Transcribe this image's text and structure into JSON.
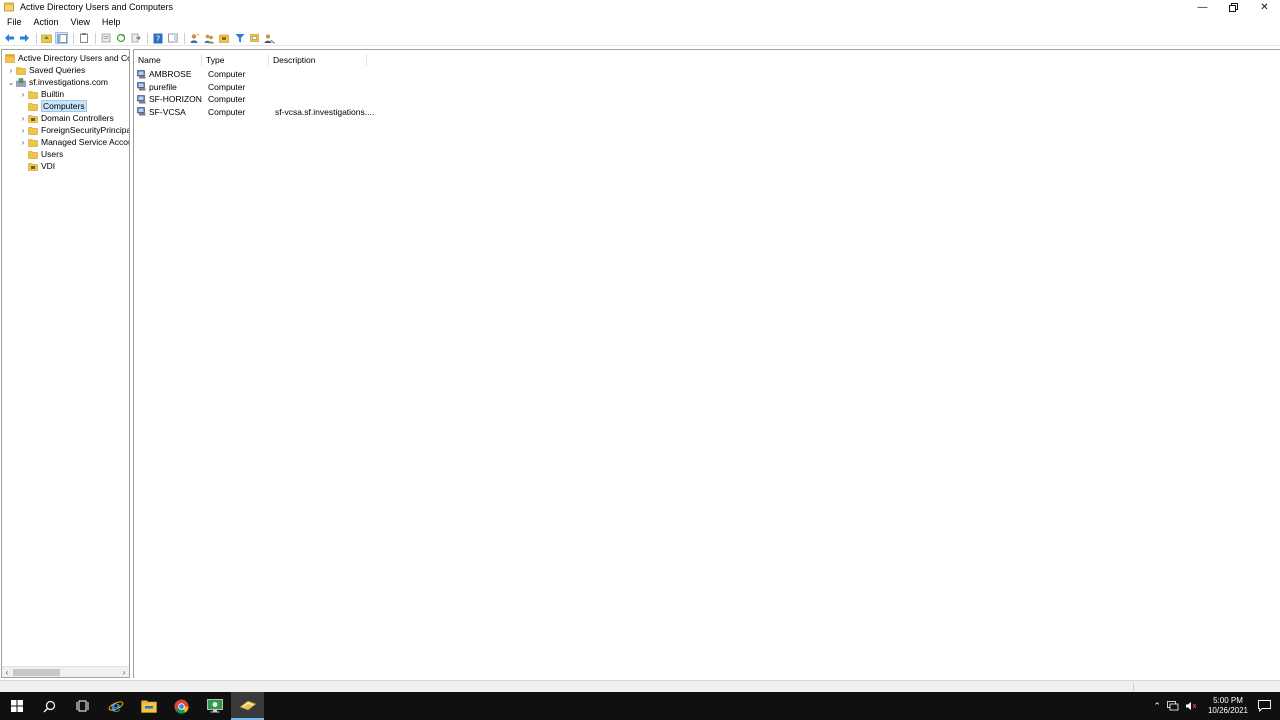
{
  "window": {
    "title": "Active Directory Users and Computers"
  },
  "menu": [
    "File",
    "Action",
    "View",
    "Help"
  ],
  "tree": [
    {
      "label": "Active Directory Users and Com",
      "indent": 0,
      "expander": "",
      "icon": "mmc-console-icon",
      "selected": false
    },
    {
      "label": "Saved Queries",
      "indent": 1,
      "expander": "›",
      "icon": "folder-icon",
      "selected": false
    },
    {
      "label": "sf.investigations.com",
      "indent": 1,
      "expander": "⌄",
      "icon": "domain-icon",
      "selected": false
    },
    {
      "label": "Builtin",
      "indent": 2,
      "expander": "›",
      "icon": "folder-icon",
      "selected": false
    },
    {
      "label": "Computers",
      "indent": 2,
      "expander": "",
      "icon": "folder-icon",
      "selected": true
    },
    {
      "label": "Domain Controllers",
      "indent": 2,
      "expander": "›",
      "icon": "ou-icon",
      "selected": false
    },
    {
      "label": "ForeignSecurityPrincipals",
      "indent": 2,
      "expander": "›",
      "icon": "folder-icon",
      "selected": false
    },
    {
      "label": "Managed Service Accour",
      "indent": 2,
      "expander": "›",
      "icon": "folder-icon",
      "selected": false
    },
    {
      "label": "Users",
      "indent": 2,
      "expander": "",
      "icon": "folder-icon",
      "selected": false
    },
    {
      "label": "VDI",
      "indent": 2,
      "expander": "",
      "icon": "ou-icon",
      "selected": false
    }
  ],
  "columns": [
    "Name",
    "Type",
    "Description"
  ],
  "rows": [
    {
      "name": "AMBROSE",
      "type": "Computer",
      "description": ""
    },
    {
      "name": "purefile",
      "type": "Computer",
      "description": ""
    },
    {
      "name": "SF-HORIZON",
      "type": "Computer",
      "description": ""
    },
    {
      "name": "SF-VCSA",
      "type": "Computer",
      "description": "sf-vcsa.sf.investigations...."
    }
  ],
  "taskbar": {
    "time": "5:00 PM",
    "date": "10/26/2021"
  },
  "colors": {
    "selection": "#cce4f7",
    "taskbar": "#101010",
    "folder": "#f3c545"
  }
}
